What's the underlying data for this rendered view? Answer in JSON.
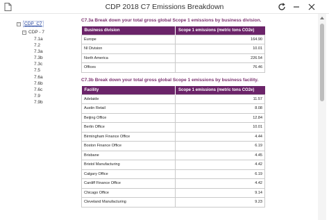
{
  "window": {
    "title": "CDP 2018 C7 Emissions Breakdown"
  },
  "tree": {
    "root": "CDP_C7",
    "c7": "CDP - 7",
    "leaves": [
      "7.1a",
      "7.2",
      "7.3a",
      "7.3b",
      "7.3c",
      "7.5",
      "7.6a",
      "7.6b",
      "7.6c",
      "7.9",
      "7.9b"
    ]
  },
  "section_a": {
    "heading": "C7.3a Break down your total gross global Scope 1 emissions by business division.",
    "columns": [
      "Business division",
      "Scope 1 emissions (metric tons CO2e)"
    ],
    "rows": [
      [
        "Europe",
        "164.90"
      ],
      [
        "NI Division",
        "10.01"
      ],
      [
        "North America",
        "226.54"
      ],
      [
        "Offices",
        "76.46"
      ]
    ]
  },
  "section_b": {
    "heading": "C7.3b Break down your total gross global Scope 1 emissions by business facility.",
    "columns": [
      "Facility",
      "Scope 1 emissions (metric tons CO2e)"
    ],
    "rows": [
      [
        "Adelaide",
        "11.57"
      ],
      [
        "Austin Retail",
        "8.08"
      ],
      [
        "Beijing Office",
        "12.84"
      ],
      [
        "Berlin Office",
        "10.01"
      ],
      [
        "Birmingham Finance Office",
        "4.44"
      ],
      [
        "Boston Finance Office",
        "6.19"
      ],
      [
        "Brisbane",
        "4.45"
      ],
      [
        "Bristol Manufacturing",
        "4.42"
      ],
      [
        "Calgary Office",
        "6.19"
      ],
      [
        "Cardiff Finance Office",
        "4.42"
      ],
      [
        "Chicago Office",
        "9.14"
      ],
      [
        "Cleveland Manufacturing",
        "9.23"
      ]
    ]
  },
  "colors": {
    "header_purple": "#6b2469",
    "heading_text": "#7a2f6e"
  }
}
